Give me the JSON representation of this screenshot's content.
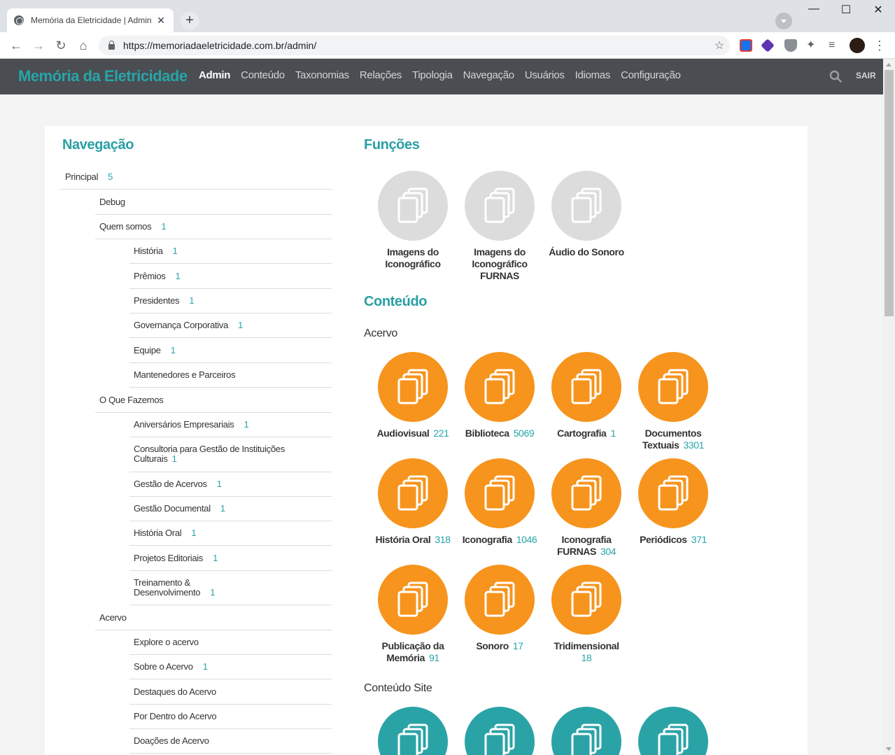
{
  "browser": {
    "tab_title": "Memória da Eletricidade | Admin",
    "tab_close": "✕",
    "new_tab": "+",
    "url": "https://memoriadaeletricidade.com.br/admin/",
    "min": "—",
    "max": "☐",
    "close": "✕",
    "back": "←",
    "forward": "→",
    "reload": "↻",
    "home": "⌂",
    "star": "☆",
    "menu": "⋮"
  },
  "header": {
    "logo": "Memória da Eletricidade",
    "nav": [
      "Admin",
      "Conteúdo",
      "Taxonomias",
      "Relações",
      "Tipologia",
      "Navegação",
      "Usuários",
      "Idiomas",
      "Configuração"
    ],
    "logout": "SAIR"
  },
  "navigation": {
    "title": "Navegação",
    "items": [
      {
        "label": "Principal",
        "count": "5"
      },
      {
        "label": "Debug",
        "count": ""
      },
      {
        "label": "Quem somos",
        "count": "1"
      },
      {
        "label": "História",
        "count": "1"
      },
      {
        "label": "Prêmios",
        "count": "1"
      },
      {
        "label": "Presidentes",
        "count": "1"
      },
      {
        "label": "Governança Corporativa",
        "count": "1"
      },
      {
        "label": "Equipe",
        "count": "1"
      },
      {
        "label": "Mantenedores e Parceiros",
        "count": ""
      },
      {
        "label": "O Que Fazemos",
        "count": ""
      },
      {
        "label": "Aniversários Empresariais",
        "count": "1"
      },
      {
        "label": "Consultoria para Gestão de Instituições Culturais",
        "count": "1"
      },
      {
        "label": "Gestão de Acervos",
        "count": "1"
      },
      {
        "label": "Gestão Documental",
        "count": "1"
      },
      {
        "label": "História Oral",
        "count": "1"
      },
      {
        "label": "Projetos Editoriais",
        "count": "1"
      },
      {
        "label": "Treinamento & Desenvolvimento",
        "count": "1"
      },
      {
        "label": "Acervo",
        "count": ""
      },
      {
        "label": "Explore o acervo",
        "count": ""
      },
      {
        "label": "Sobre o Acervo",
        "count": "1"
      },
      {
        "label": "Destaques do Acervo",
        "count": ""
      },
      {
        "label": "Por Dentro do Acervo",
        "count": ""
      },
      {
        "label": "Doações de Acervo",
        "count": ""
      }
    ]
  },
  "funcoes": {
    "title": "Funções",
    "items": [
      {
        "label": "Imagens do Iconográfico"
      },
      {
        "label": "Imagens do Iconográfico FURNAS"
      },
      {
        "label": "Áudio do Sonoro"
      }
    ]
  },
  "conteudo": {
    "title": "Conteúdo",
    "acervo_title": "Acervo",
    "acervo": [
      {
        "label": "Audiovisual",
        "count": "221"
      },
      {
        "label": "Biblioteca",
        "count": "5069"
      },
      {
        "label": "Cartografia",
        "count": "1"
      },
      {
        "label": "Documentos Textuais",
        "count": "3301"
      },
      {
        "label": "História Oral",
        "count": "318"
      },
      {
        "label": "Iconografia",
        "count": "1046"
      },
      {
        "label": "Iconografia FURNAS",
        "count": "304"
      },
      {
        "label": "Periódicos",
        "count": "371"
      },
      {
        "label": "Publicação da Memória",
        "count": "91"
      },
      {
        "label": "Sonoro",
        "count": "17"
      },
      {
        "label": "Tridimensional",
        "count": "18"
      }
    ],
    "site_title": "Conteúdo Site"
  },
  "colors": {
    "accent": "#27a5a8",
    "orange": "#f7941d",
    "grey": "#dcdcdc",
    "header": "#4a4d52"
  }
}
